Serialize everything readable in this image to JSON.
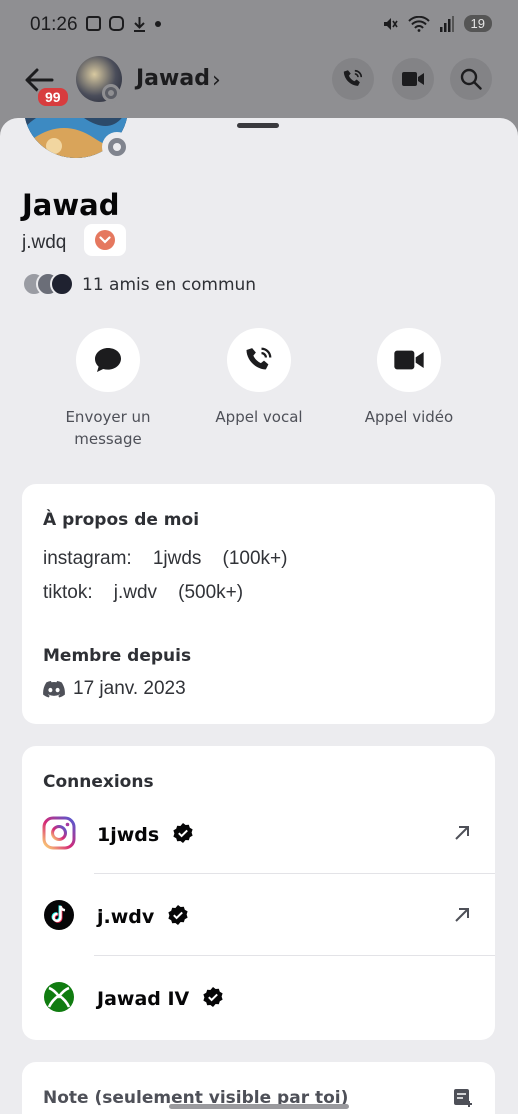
{
  "status_bar": {
    "time": "01:26",
    "battery": "19"
  },
  "header": {
    "unread_count": "99",
    "name": "Jawad",
    "chevron": "›"
  },
  "profile": {
    "display_name": "Jawad",
    "username": "j.wdq",
    "mutual_friends": "11 amis en commun"
  },
  "actions": [
    {
      "label": "Envoyer un\nmessage",
      "icon": "chat-bubble-icon"
    },
    {
      "label": "Appel vocal",
      "icon": "phone-call-icon"
    },
    {
      "label": "Appel vidéo",
      "icon": "video-camera-icon"
    }
  ],
  "about": {
    "title": "À propos de moi",
    "lines": [
      "instagram:    1jwds    (100k+)",
      "tiktok:    j.wdv    (500k+)"
    ],
    "member_since_title": "Membre depuis",
    "member_since_date": "17 janv. 2023"
  },
  "connections": {
    "title": "Connexions",
    "items": [
      {
        "name": "1jwds",
        "service": "instagram",
        "external": true
      },
      {
        "name": "j.wdv",
        "service": "tiktok",
        "external": true
      },
      {
        "name": "Jawad IV",
        "service": "xbox",
        "external": false
      }
    ]
  },
  "note": {
    "title": "Note (seulement visible par toi)"
  },
  "colors": {
    "accent_badge": "#e5785f",
    "unread_badge": "#d83c3e",
    "instagram_gradient": [
      "#feda75",
      "#d62976",
      "#4f5bd5"
    ],
    "xbox_green": "#107c10"
  }
}
